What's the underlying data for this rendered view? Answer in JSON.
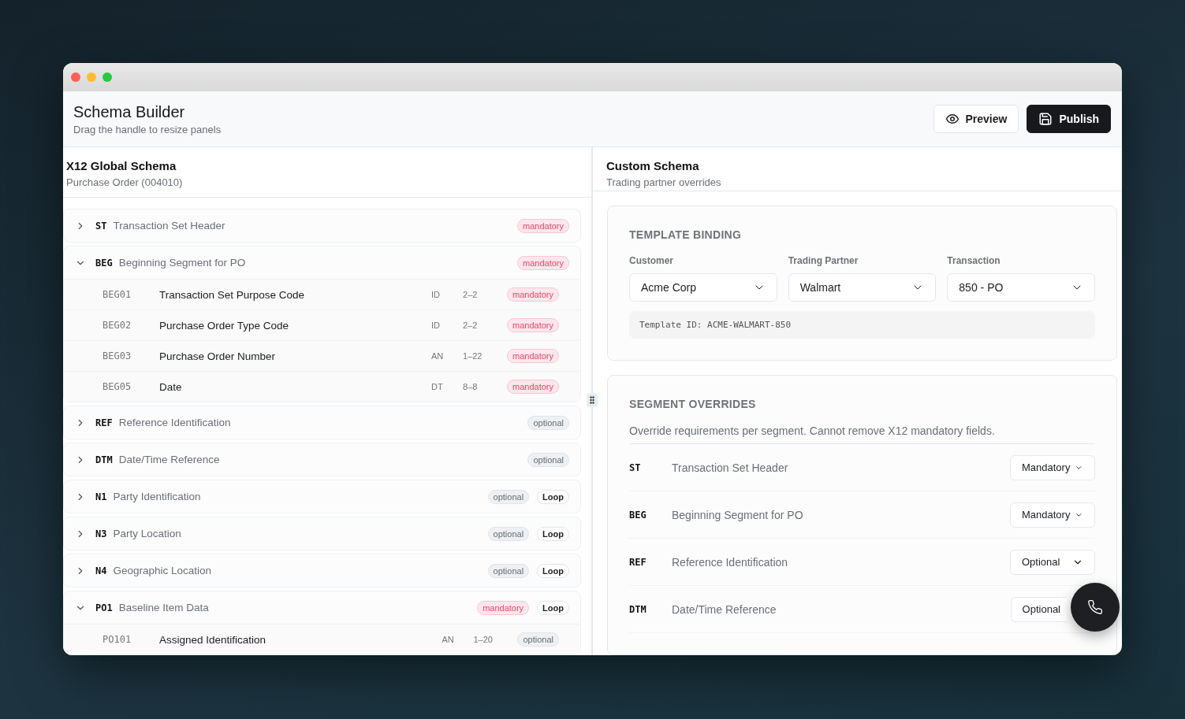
{
  "window": {
    "title": "Schema Builder",
    "subtitle": "Drag the handle to resize panels"
  },
  "actions": [
    {
      "label": "Preview",
      "kind": "secondary"
    },
    {
      "label": "Publish",
      "kind": "primary"
    }
  ],
  "global_panel": {
    "title": "X12 Global Schema",
    "subtitle": "Purchase Order (004010)",
    "segments": [
      {
        "code": "ST",
        "name": "Transaction Set Header",
        "expanded": false,
        "requirement": {
          "label": "mandatory",
          "kind": "mandatory"
        }
      },
      {
        "code": "BEG",
        "name": "Beginning Segment for PO",
        "expanded": true,
        "requirement": {
          "label": "mandatory",
          "kind": "mandatory"
        },
        "children": [
          {
            "code": "BEG01",
            "name": "Transaction Set Purpose Code",
            "type": "ID",
            "length": "2–2",
            "requirement": {
              "label": "mandatory",
              "kind": "mandatory"
            }
          },
          {
            "code": "BEG02",
            "name": "Purchase Order Type Code",
            "type": "ID",
            "length": "2–2",
            "requirement": {
              "label": "mandatory",
              "kind": "mandatory"
            }
          },
          {
            "code": "BEG03",
            "name": "Purchase Order Number",
            "type": "AN",
            "length": "1–22",
            "requirement": {
              "label": "mandatory",
              "kind": "mandatory"
            }
          },
          {
            "code": "BEG05",
            "name": "Date",
            "type": "DT",
            "length": "8–8",
            "requirement": {
              "label": "mandatory",
              "kind": "mandatory"
            }
          }
        ]
      },
      {
        "code": "REF",
        "name": "Reference Identification",
        "expanded": false,
        "requirement": {
          "label": "optional",
          "kind": "optional"
        }
      },
      {
        "code": "DTM",
        "name": "Date/Time Reference",
        "expanded": false,
        "requirement": {
          "label": "optional",
          "kind": "optional"
        }
      },
      {
        "code": "N1",
        "name": "Party Identification",
        "expanded": false,
        "requirement": {
          "label": "optional",
          "kind": "optional"
        },
        "loop": "Loop"
      },
      {
        "code": "N3",
        "name": "Party Location",
        "expanded": false,
        "requirement": {
          "label": "optional",
          "kind": "optional"
        },
        "loop": "Loop"
      },
      {
        "code": "N4",
        "name": "Geographic Location",
        "expanded": false,
        "requirement": {
          "label": "optional",
          "kind": "optional"
        },
        "loop": "Loop"
      },
      {
        "code": "PO1",
        "name": "Baseline Item Data",
        "expanded": true,
        "requirement": {
          "label": "mandatory",
          "kind": "mandatory"
        },
        "loop": "Loop",
        "children": [
          {
            "code": "PO101",
            "name": "Assigned Identification",
            "type": "AN",
            "length": "1–20",
            "requirement": {
              "label": "optional",
              "kind": "optional"
            }
          }
        ]
      }
    ]
  },
  "custom_panel": {
    "title": "Custom Schema",
    "subtitle": "Trading partner overrides",
    "template_binding": {
      "title": "TEMPLATE BINDING",
      "fields": [
        {
          "label": "Customer",
          "value": "Acme Corp"
        },
        {
          "label": "Trading Partner",
          "value": "Walmart"
        },
        {
          "label": "Transaction",
          "value": "850 - PO"
        }
      ],
      "template_id": "Template ID: ACME-WALMART-850"
    },
    "segment_overrides": {
      "title": "SEGMENT OVERRIDES",
      "description": "Override requirements per segment. Cannot remove X12 mandatory fields.",
      "rows": [
        {
          "code": "ST",
          "name": "Transaction Set Header",
          "value": "Mandatory"
        },
        {
          "code": "BEG",
          "name": "Beginning Segment for PO",
          "value": "Mandatory"
        },
        {
          "code": "REF",
          "name": "Reference Identification",
          "value": "Optional"
        },
        {
          "code": "DTM",
          "name": "Date/Time Reference",
          "value": "Optional"
        }
      ]
    }
  }
}
